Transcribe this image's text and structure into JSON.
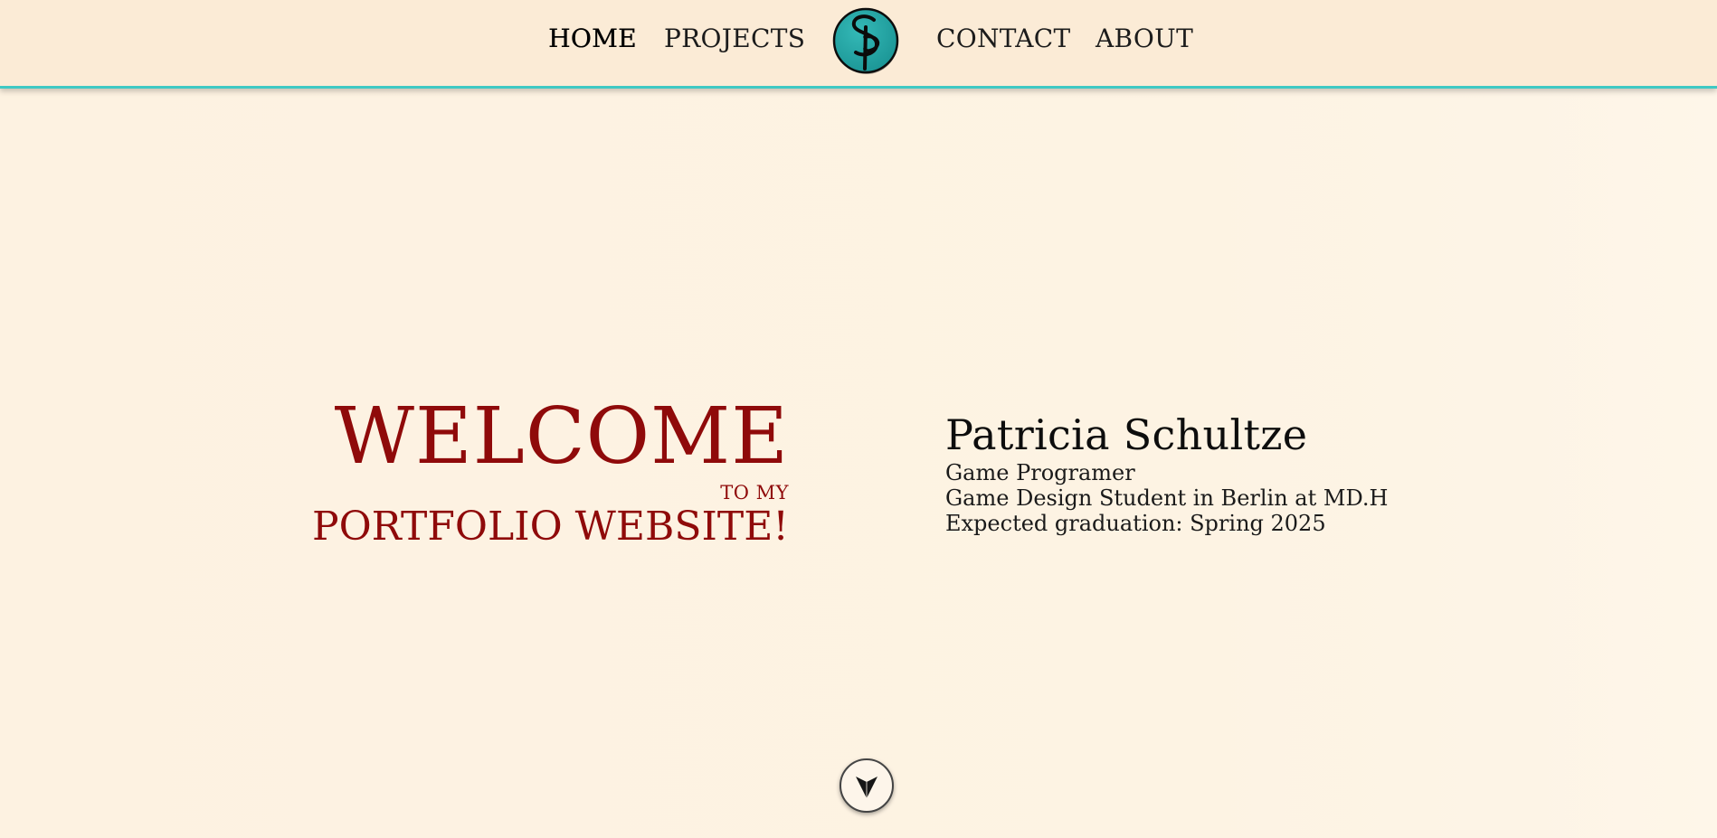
{
  "nav": {
    "items": [
      {
        "label": "HOME",
        "active": true
      },
      {
        "label": "PROJECTS",
        "active": false
      },
      {
        "label": "CONTACT",
        "active": false
      },
      {
        "label": "ABOUT",
        "active": false
      }
    ],
    "logo": {
      "icon": "sp-monogram-logo-icon",
      "color": "#23a3a3"
    }
  },
  "hero": {
    "welcome": "WELCOME",
    "to_my": "TO MY",
    "subtitle": "PORTFOLIO WEBSITE!",
    "accent_color": "#8f0a0a"
  },
  "bio": {
    "name": "Patricia Schultze",
    "lines": [
      "Game Programer",
      "Game Design Student in Berlin at MD.H",
      "Expected graduation: Spring 2025"
    ]
  },
  "scroll_button": {
    "icon": "arrow-down-icon"
  },
  "colors": {
    "background": "#fdf2e1",
    "navbar": "#fbebd6",
    "navbar_border": "#3fc9c4"
  }
}
